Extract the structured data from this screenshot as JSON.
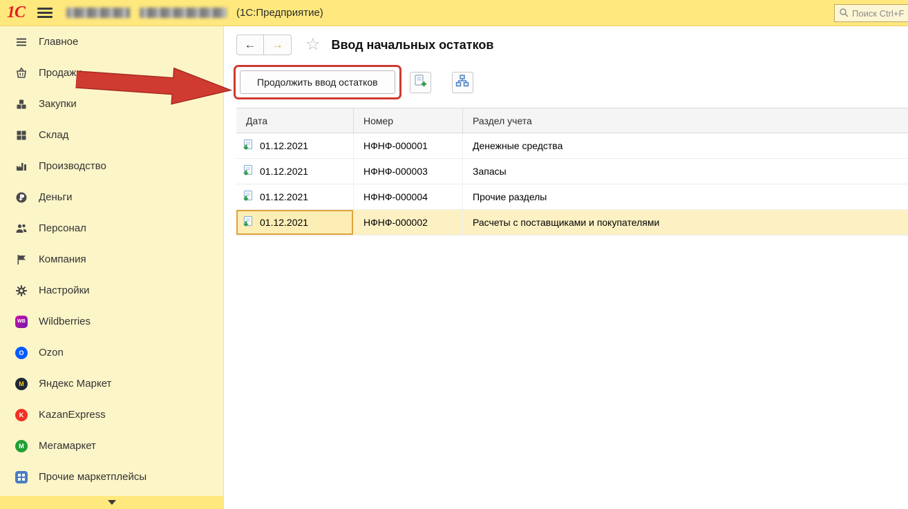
{
  "topbar": {
    "app_suffix": "(1С:Предприятие)",
    "search_placeholder": "Поиск Ctrl+F"
  },
  "nav": {
    "title": "Ввод начальных остатков"
  },
  "toolbar": {
    "continue_label": "Продолжить ввод остатков"
  },
  "sidebar": {
    "items": [
      {
        "label": "Главное",
        "icon": "list-icon"
      },
      {
        "label": "Продажи",
        "icon": "basket-icon"
      },
      {
        "label": "Закупки",
        "icon": "purchases-icon"
      },
      {
        "label": "Склад",
        "icon": "warehouse-icon"
      },
      {
        "label": "Производство",
        "icon": "production-icon"
      },
      {
        "label": "Деньги",
        "icon": "ruble-icon"
      },
      {
        "label": "Персонал",
        "icon": "people-icon"
      },
      {
        "label": "Компания",
        "icon": "flag-icon"
      },
      {
        "label": "Настройки",
        "icon": "gear-icon"
      },
      {
        "label": "Wildberries",
        "icon": "wildberries-icon",
        "badge": "WB"
      },
      {
        "label": "Ozon",
        "icon": "ozon-icon",
        "badge": "O"
      },
      {
        "label": "Яндекс Маркет",
        "icon": "yandex-market-icon",
        "badge": "М"
      },
      {
        "label": "KazanExpress",
        "icon": "kazanexpress-icon",
        "badge": "K"
      },
      {
        "label": "Мегамаркет",
        "icon": "megamarket-icon",
        "badge": "М"
      },
      {
        "label": "Прочие маркетплейсы",
        "icon": "marketplaces-icon"
      }
    ]
  },
  "table": {
    "columns": [
      "Дата",
      "Номер",
      "Раздел учета"
    ],
    "rows": [
      {
        "date": "01.12.2021",
        "number": "НФНФ-000001",
        "section": "Денежные средства",
        "selected": false
      },
      {
        "date": "01.12.2021",
        "number": "НФНФ-000003",
        "section": "Запасы",
        "selected": false
      },
      {
        "date": "01.12.2021",
        "number": "НФНФ-000004",
        "section": "Прочие разделы",
        "selected": false
      },
      {
        "date": "01.12.2021",
        "number": "НФНФ-000002",
        "section": "Расчеты с поставщиками и покупателями",
        "selected": true
      }
    ]
  },
  "colors": {
    "topbar_yellow": "#ffe87d",
    "sidebar_yellow": "#fcf5c8",
    "annotation_red": "#ce3a30",
    "selected_row": "#fdf1c4",
    "selection_border": "#e2a23b"
  }
}
